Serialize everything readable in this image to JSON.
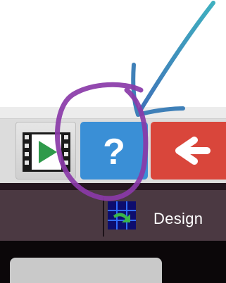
{
  "toolbar": {
    "video_button": {
      "icon": "film-play-icon",
      "color": "#2e9a4a"
    },
    "help_button": {
      "label": "?",
      "color": "#3a8fd6",
      "icon": "question-icon"
    },
    "back_button": {
      "icon": "arrow-left-icon",
      "color": "#d9463b"
    }
  },
  "tabs": {
    "design_label": "Design",
    "design_icon": "design-grid-icon"
  },
  "annotation": {
    "circle_color": "#8a3aa8",
    "arrow_color": "#3fb0c0"
  }
}
